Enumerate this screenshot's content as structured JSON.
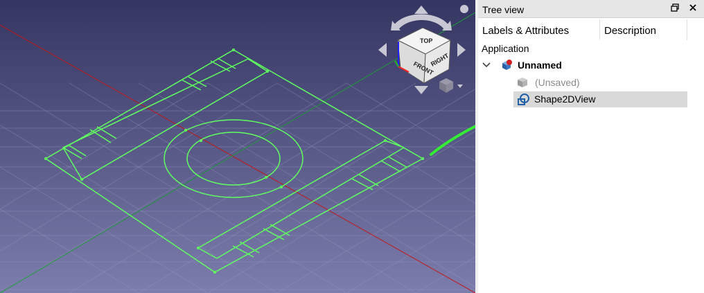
{
  "tree_view": {
    "title": "Tree view",
    "columns": [
      "Labels & Attributes",
      "Description"
    ],
    "root_label": "Application",
    "items": [
      {
        "label": "Unnamed",
        "icon": "document-icon",
        "expanded": true,
        "bold": true
      },
      {
        "label": "(Unsaved)",
        "icon": "unsaved-cube-icon",
        "muted": true
      },
      {
        "label": "Shape2DView",
        "icon": "shape2dview-icon",
        "selected": true
      }
    ]
  },
  "viewport": {
    "background_top": "#353562",
    "background_bottom": "#7a7aaa",
    "wireframe_color": "#5fff5f",
    "annotation_arrow_color": "#33ee33"
  },
  "navigation_cube": {
    "face_labels": [
      "FRONT",
      "RIGHT",
      "TOP"
    ]
  }
}
